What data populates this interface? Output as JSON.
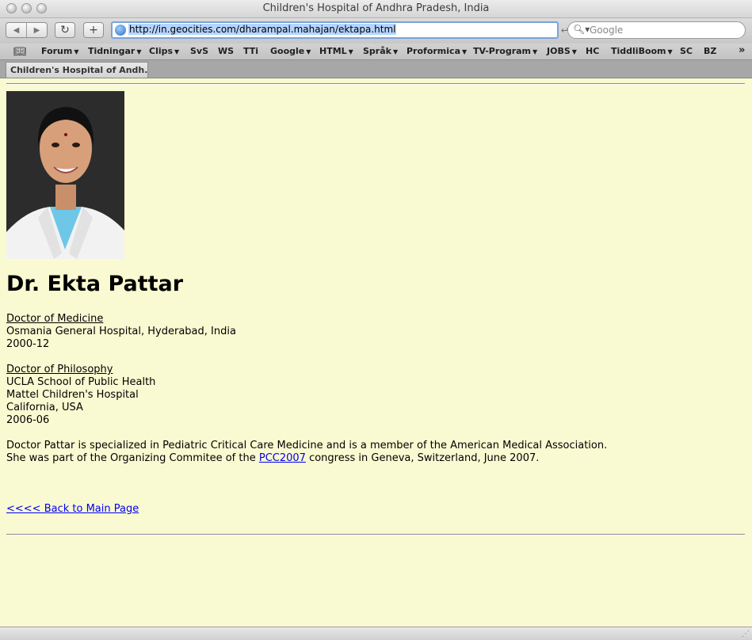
{
  "window": {
    "title": "Children's Hospital of Andhra Pradesh, India"
  },
  "toolbar": {
    "url": "http://in.geocities.com/dharampal.mahajan/ektapa.html",
    "search_placeholder": "Google"
  },
  "bookmarks": [
    {
      "label": "Forum",
      "menu": true
    },
    {
      "label": "Tidningar",
      "menu": true
    },
    {
      "label": "Clips",
      "menu": true
    },
    {
      "label": "SvS",
      "menu": false
    },
    {
      "label": "WS",
      "menu": false
    },
    {
      "label": "TTi",
      "menu": false
    },
    {
      "label": "Google",
      "menu": true
    },
    {
      "label": "HTML",
      "menu": true
    },
    {
      "label": "Språk",
      "menu": true
    },
    {
      "label": "Proformica",
      "menu": true
    },
    {
      "label": "TV-Program",
      "menu": true
    },
    {
      "label": "JOBS",
      "menu": true
    },
    {
      "label": "HC",
      "menu": false
    },
    {
      "label": "TiddliBoom",
      "menu": true
    },
    {
      "label": "SC",
      "menu": false
    },
    {
      "label": "BZ",
      "menu": false
    }
  ],
  "tab": {
    "label": "Children's Hospital of Andh..."
  },
  "page": {
    "name": "Dr. Ekta Pattar",
    "degree1": {
      "title": "Doctor of Medicine",
      "school": "Osmania General Hospital, Hyderabad, India",
      "years": "2000-12"
    },
    "degree2": {
      "title": "Doctor of Philosophy",
      "school": "UCLA School of Public Health",
      "hospital": "Mattel Children's Hospital",
      "location": "California, USA",
      "years": "2006-06"
    },
    "bio_line1": "Doctor Pattar is specialized in Pediatric Critical Care Medicine and is a member of the American Medical Association.",
    "bio_line2_pre": "She was part of the Organizing Commitee of the ",
    "bio_link": "PCC2007",
    "bio_line2_post": " congress in Geneva, Switzerland, June 2007.",
    "back_link": "<<<< Back to Main Page",
    "colors": {
      "background": "#fafad2",
      "link": "#0000ee"
    }
  }
}
